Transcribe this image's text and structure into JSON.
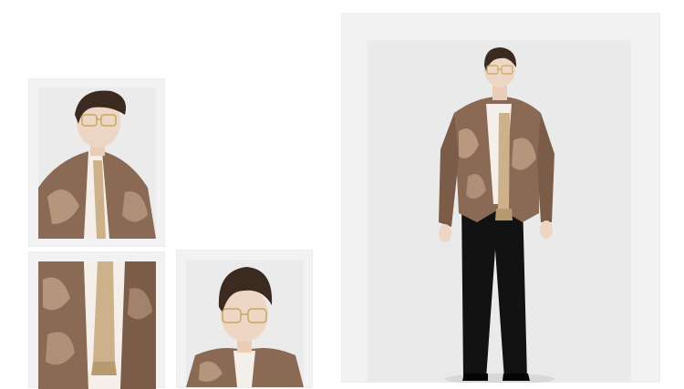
{
  "photos": [
    {
      "subject": "polaroid-portrait-top-left"
    },
    {
      "subject": "polaroid-jacket-detail-bottom-left"
    },
    {
      "subject": "polaroid-portrait-bottom-center"
    },
    {
      "subject": "full-length-look-right"
    }
  ],
  "colors": {
    "background": "#ffffff",
    "frame": "#f2f2f2",
    "photo_backdrop": "#e9e9e9",
    "jacket_bronze": "#8a6a55",
    "jacket_highlight": "#c9a88f",
    "shirt": "#f4efe8",
    "scarf": "#cdb18a",
    "hair": "#3b2a20",
    "trousers": "#121212"
  }
}
